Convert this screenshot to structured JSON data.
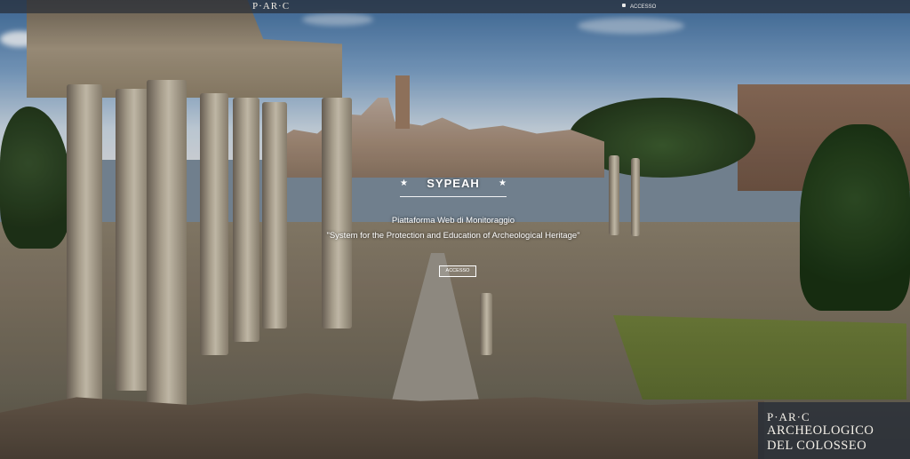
{
  "topbar": {
    "logo_text": "P·AR·C",
    "login_label": "ACCESSO"
  },
  "hero": {
    "title": "SYPEAH",
    "subtitle": "Piattaforma Web di Monitoraggio",
    "quote": "\"System for the Protection and Education of Archeological Heritage\"",
    "button_label": "ACCESSO"
  },
  "footer_logo": {
    "line1": "P·AR·C",
    "line2": "ARCHEOLOGICO",
    "line3": "DEL COLOSSEO"
  },
  "icons": {
    "title_decoration": "star-icon",
    "login": "lock-icon"
  }
}
